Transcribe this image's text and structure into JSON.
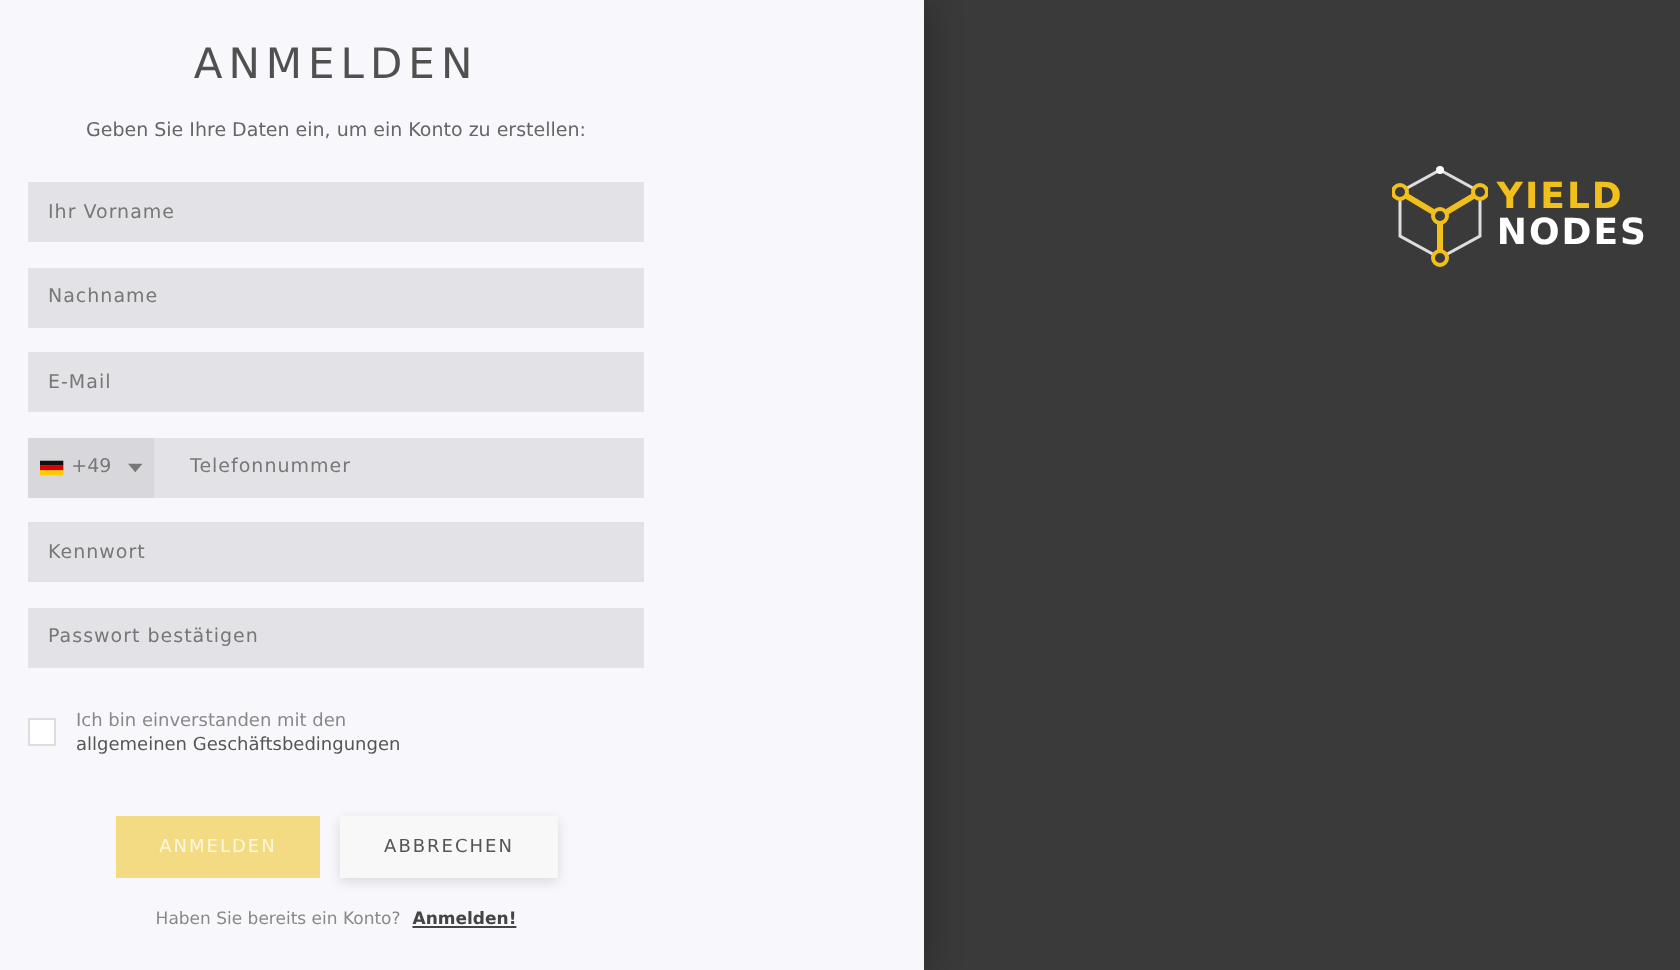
{
  "form": {
    "title": "ANMELDEN",
    "subtitle": "Geben Sie Ihre Daten ein, um ein Konto zu erstellen:",
    "fields": [
      {
        "kind": "text",
        "placeholder": "Ihr Vorname"
      },
      {
        "kind": "text",
        "placeholder": "Nachname"
      },
      {
        "kind": "text",
        "placeholder": "E-Mail"
      },
      {
        "kind": "phone",
        "country_code": "+49",
        "placeholder": "Telefonnummer"
      },
      {
        "kind": "text",
        "placeholder": "Kennwort"
      },
      {
        "kind": "text",
        "placeholder": "Passwort bestätigen"
      }
    ],
    "terms": {
      "checked": false,
      "line_1": "Ich bin einverstanden mit den",
      "line_2": "allgemeinen Geschäftsbedingungen"
    },
    "submit": {
      "label": "ANMELDEN",
      "disabled": true
    },
    "cancel": {
      "label": "ABBRECHEN"
    },
    "footer": {
      "text": "Haben Sie bereits ein Konto?",
      "link": "Anmelden!"
    }
  },
  "brand": {
    "line_1": "YIELD",
    "line_2": "NODES"
  }
}
